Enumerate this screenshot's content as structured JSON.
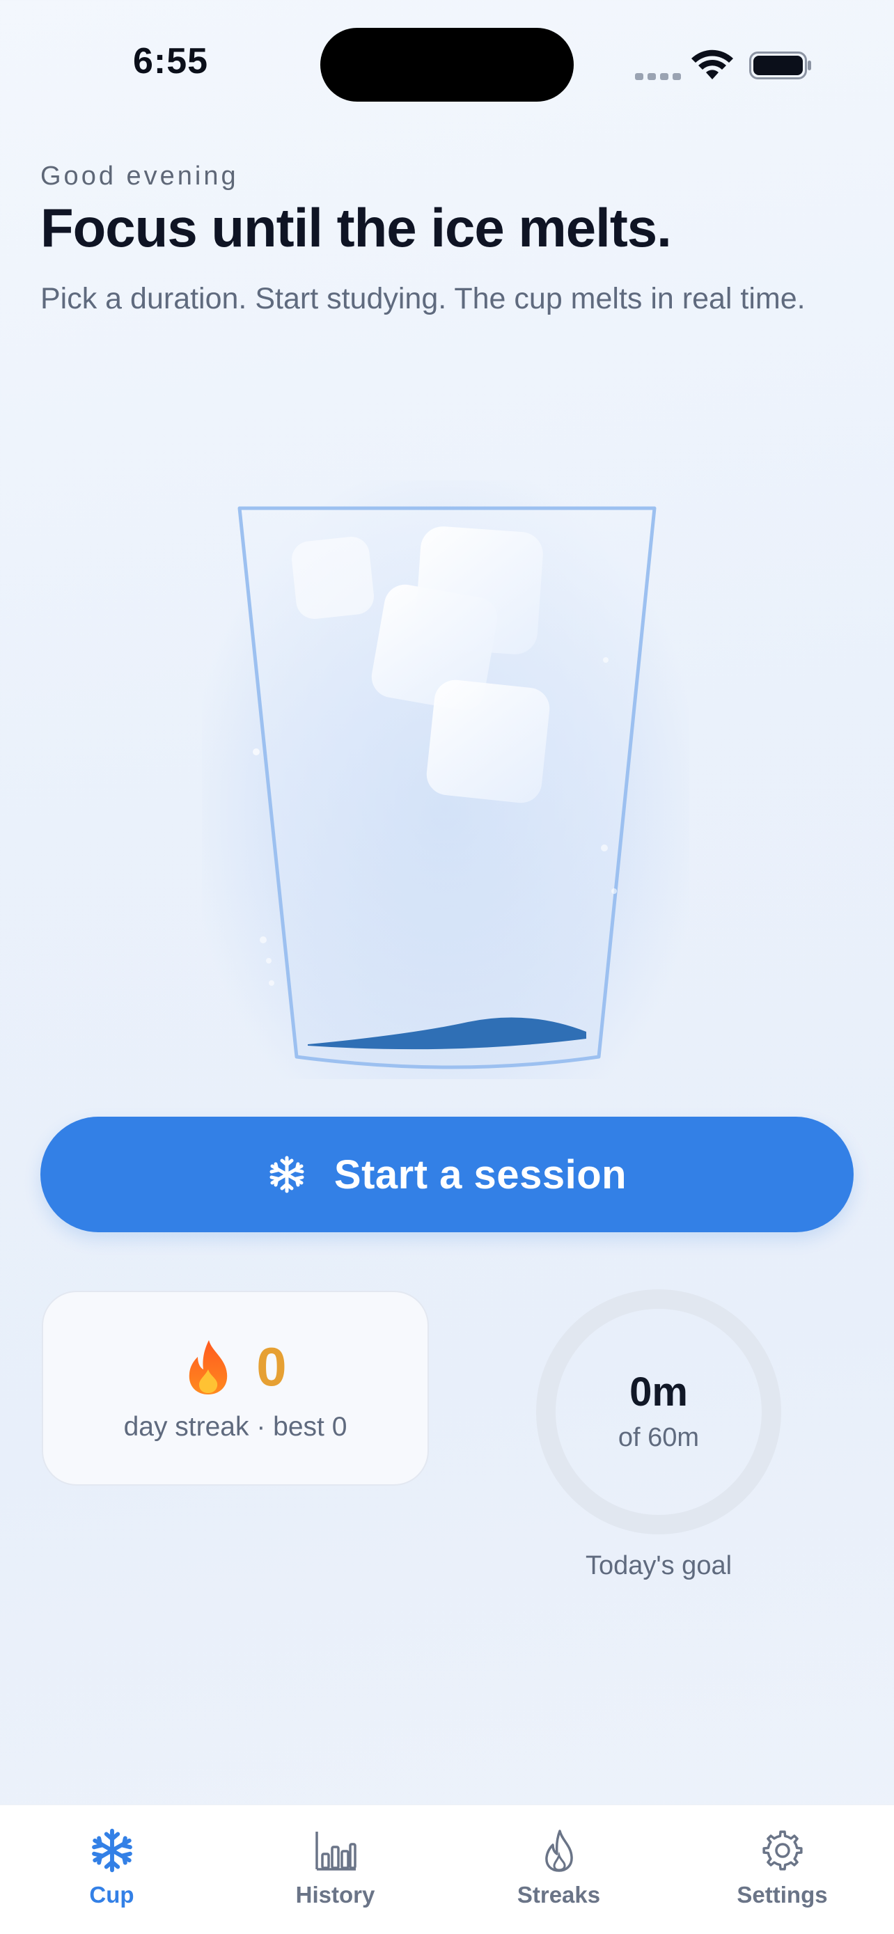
{
  "status_bar": {
    "time": "6:55"
  },
  "header": {
    "greeting": "Good evening",
    "title": "Focus until the ice melts.",
    "subtitle": "Pick a duration. Start studying. The cup melts in real time."
  },
  "cup": {
    "icon": "ice-cup-illustration"
  },
  "start_button": {
    "icon": "snowflake-icon",
    "label": "Start a session"
  },
  "streak": {
    "icon": "flame-icon",
    "count": "0",
    "caption": "day streak · best 0"
  },
  "goal": {
    "value": "0m",
    "of_label": "of 60m",
    "caption": "Today's goal",
    "progress_fraction": 0
  },
  "tabs": [
    {
      "label": "Cup",
      "icon": "snowflake-icon",
      "active": true
    },
    {
      "label": "History",
      "icon": "bar-chart-icon",
      "active": false
    },
    {
      "label": "Streaks",
      "icon": "flame-outline-icon",
      "active": false
    },
    {
      "label": "Settings",
      "icon": "gear-icon",
      "active": false
    }
  ],
  "colors": {
    "accent": "#3380e6",
    "streak": "#e6a033",
    "water": "#2f6fb5"
  }
}
